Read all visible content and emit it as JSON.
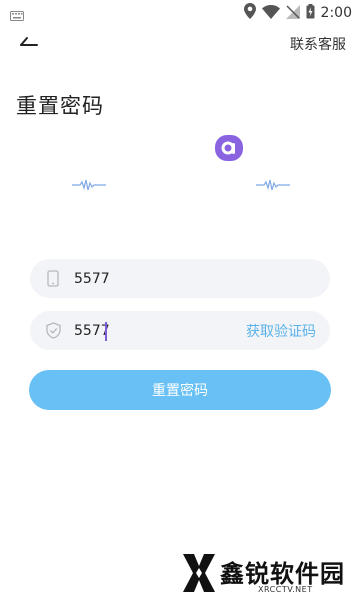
{
  "status_bar": {
    "time": "2:00",
    "icons": [
      "keyboard-icon",
      "location-icon",
      "wifi-icon",
      "signal-off-icon",
      "battery-icon"
    ]
  },
  "header": {
    "back_icon": "back-arrow-icon",
    "customer_service": "联系客服"
  },
  "page": {
    "title": "重置密码",
    "logo_letter": "a"
  },
  "form": {
    "phone": {
      "icon": "phone-icon",
      "value": "5577"
    },
    "code": {
      "icon": "shield-icon",
      "value": "5577",
      "get_code": "获取验证码"
    },
    "submit": "重置密码"
  },
  "watermark": {
    "text": "鑫锐软件园",
    "sub": "XRCCTV.NET"
  },
  "colors": {
    "accent": "#69c0f4",
    "link": "#5ab2ea",
    "logo": "#8a63e0",
    "field_bg": "#f3f4f7"
  }
}
